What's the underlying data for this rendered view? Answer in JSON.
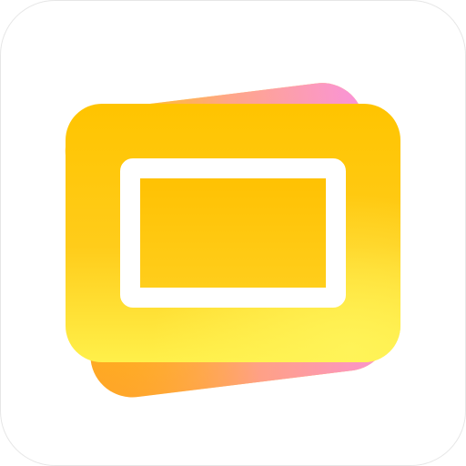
{
  "icon": {
    "name": "slideshow-app-icon",
    "glyph": "picture-frame-icon",
    "colors": {
      "background": "#FFFFFF",
      "border": "#E6E6E6",
      "front_card_top": "#FFC400",
      "front_card_bottom": "#FFF04A",
      "back_card_yellow": "#FFD21A",
      "back_card_orange": "#FFA726",
      "back_card_pink": "#F98CF0",
      "frame_stroke": "#FFFFFF",
      "frame_fill": "#FFC000"
    }
  }
}
